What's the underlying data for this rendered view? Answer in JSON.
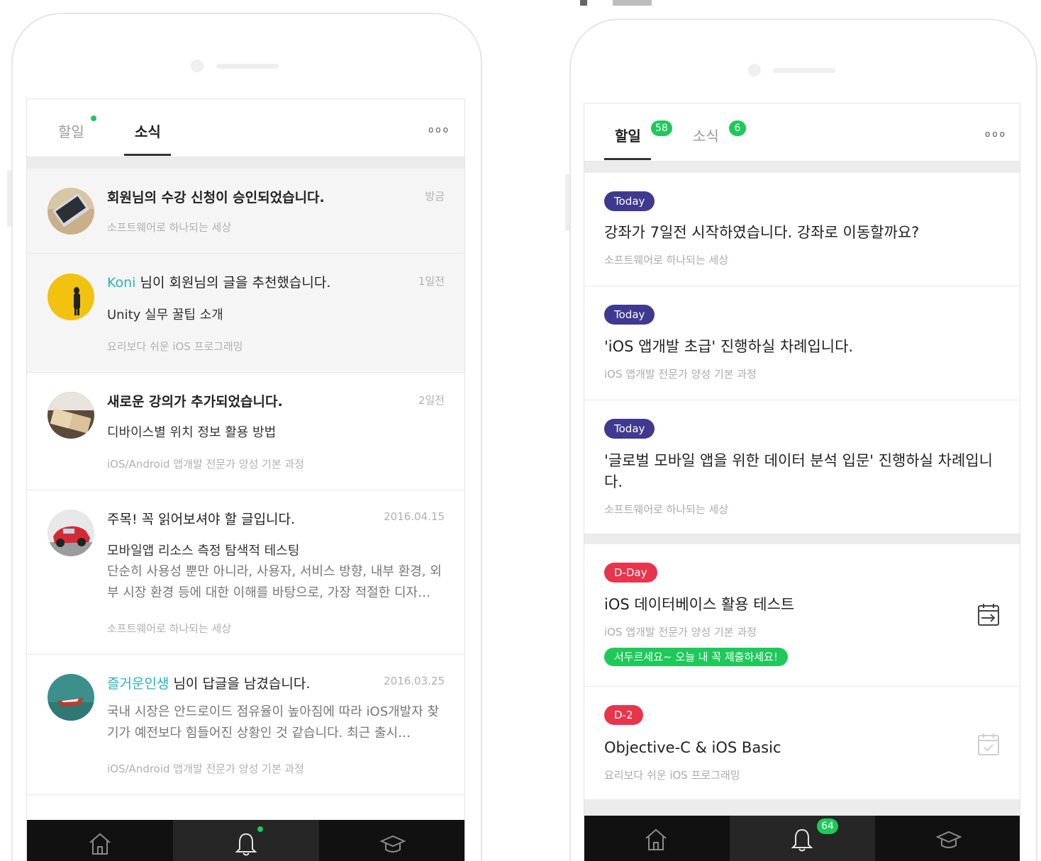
{
  "left_screen": {
    "tabs": [
      {
        "label": "할일",
        "active": false,
        "has_new_dot": true
      },
      {
        "label": "소식",
        "active": true
      }
    ],
    "more_label": "ooo",
    "feed": [
      {
        "title": "회원님의 수강 신청이 승인되었습니다.",
        "time": "방금",
        "meta": "소프트웨어로 하나되는 세상",
        "avatar": "laptop-photo"
      },
      {
        "actor": "Koni",
        "title": "님이 회원님의 글을 추천했습니다.",
        "subtitle": "Unity 실무 꿀팁 소개",
        "time": "1일전",
        "meta": "요리보다 쉬운 iOS 프로그래밍",
        "avatar": "yellow-figure-photo"
      },
      {
        "title": "새로운 강의가 추가되었습니다.",
        "subtitle": "디바이스별 위치 정보 활용 방법",
        "time": "2일전",
        "meta": "iOS/Android 앱개발 전문가 양성 기본 과정",
        "avatar": "notebook-photo"
      },
      {
        "title": "주목! 꼭 읽어보셔야 할 글입니다.",
        "subtitle": "모바일앱 리소스 측정 탐색적 테스팅",
        "desc": "단순히 사용성 뿐만 아니라, 사용자, 서비스 방향, 내부 환경, 외부 시장 환경 등에 대한 이해를 바탕으로, 가장 적절한 디자…",
        "time": "2016.04.15",
        "meta": "소프트웨어로 하나되는 세상",
        "avatar": "red-car-photo"
      },
      {
        "actor": "즐거운인생",
        "title": "님이 답글을 남겼습니다.",
        "desc": "국내 시장은 안드로이드 점유율이 높아짐에 따라 iOS개발자 찾기가 예전보다 힘들어진 상황인 것 같습니다. 최근 출시…",
        "time": "2016.03.25",
        "meta": "iOS/Android 앱개발 전문가 양성 기본 과정",
        "avatar": "boat-photo"
      }
    ],
    "tabbar": [
      {
        "icon": "home-icon",
        "selected": false
      },
      {
        "icon": "bell-icon",
        "selected": true,
        "dot": true
      },
      {
        "icon": "graduation-cap-icon",
        "selected": false
      }
    ]
  },
  "right_screen": {
    "tabs": [
      {
        "label": "할일",
        "active": true,
        "count": "58"
      },
      {
        "label": "소식",
        "active": false,
        "count": "6"
      }
    ],
    "more_label": "ooo",
    "cards": [
      {
        "badge": "Today",
        "badge_type": "today",
        "title": "강좌가 7일전 시작하였습니다. 강좌로 이동할까요?",
        "meta": "소프트웨어로 하나되는 세상"
      },
      {
        "badge": "Today",
        "badge_type": "today",
        "title": "'iOS 앱개발 초급' 진행하실 차례입니다.",
        "meta": "iOS 앱개발 전문가 양성 기본 과정"
      },
      {
        "badge": "Today",
        "badge_type": "today",
        "title": "'글로벌 모바일 앱을 위한 데이터 분석 입문' 진행하실 차례입니다.",
        "meta": "소프트웨어로 하나되는 세상"
      },
      {
        "badge": "D-Day",
        "badge_type": "dday",
        "title": "iOS 데이터베이스 활용 테스트",
        "meta": "iOS 앱개발 전문가 양성 기본 과정",
        "nudge": "서두르세요~ 오늘 내 꼭 제출하세요!",
        "action_icon": "calendar-submit-icon"
      },
      {
        "badge": "D-2",
        "badge_type": "dday",
        "title": "Objective-C & iOS Basic",
        "meta": "요리보다 쉬운 iOS 프로그래밍",
        "action_icon": "calendar-check-icon"
      }
    ],
    "tabbar": [
      {
        "icon": "home-icon",
        "selected": false
      },
      {
        "icon": "bell-icon",
        "selected": true,
        "badge": "64"
      },
      {
        "icon": "graduation-cap-icon",
        "selected": false
      }
    ]
  },
  "colors": {
    "accent_green": "#1ec95a",
    "today_badge": "#3f3a8f",
    "dday_badge": "#e8354c",
    "link_teal": "#24b2c6",
    "tabbar": "#111111"
  }
}
